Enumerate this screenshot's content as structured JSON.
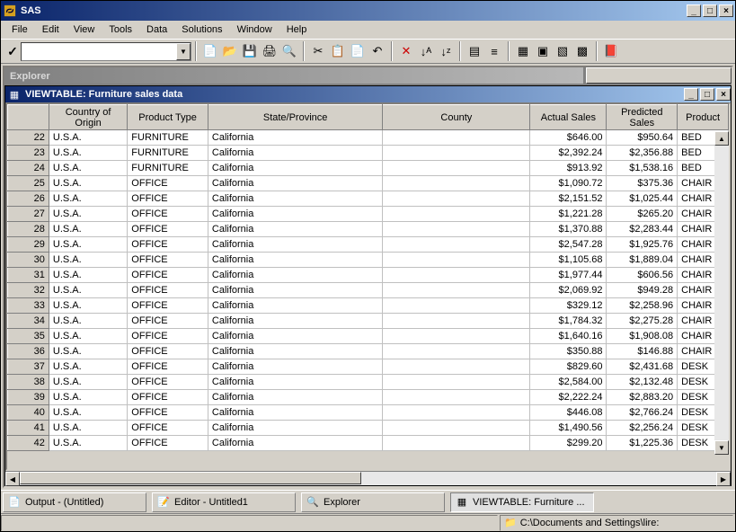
{
  "app": {
    "title": "SAS"
  },
  "menu": [
    "File",
    "Edit",
    "View",
    "Tools",
    "Data",
    "Solutions",
    "Window",
    "Help"
  ],
  "explorer_label": "Explorer",
  "viewtable": {
    "title": "VIEWTABLE: Furniture sales data"
  },
  "columns": [
    {
      "key": "country",
      "label": "Country of Origin",
      "w": 80,
      "align": "left"
    },
    {
      "key": "ptype",
      "label": "Product Type",
      "w": 82,
      "align": "left"
    },
    {
      "key": "state",
      "label": "State/Province",
      "w": 178,
      "align": "left"
    },
    {
      "key": "county",
      "label": "County",
      "w": 150,
      "align": "left"
    },
    {
      "key": "actual",
      "label": "Actual Sales",
      "w": 78,
      "align": "right"
    },
    {
      "key": "predicted",
      "label": "Predicted Sales",
      "w": 72,
      "align": "right"
    },
    {
      "key": "product",
      "label": "Product",
      "w": 52,
      "align": "left"
    }
  ],
  "rows": [
    {
      "n": 22,
      "country": "U.S.A.",
      "ptype": "FURNITURE",
      "state": "California",
      "county": "",
      "actual": "$646.00",
      "predicted": "$950.64",
      "product": "BED"
    },
    {
      "n": 23,
      "country": "U.S.A.",
      "ptype": "FURNITURE",
      "state": "California",
      "county": "",
      "actual": "$2,392.24",
      "predicted": "$2,356.88",
      "product": "BED"
    },
    {
      "n": 24,
      "country": "U.S.A.",
      "ptype": "FURNITURE",
      "state": "California",
      "county": "",
      "actual": "$913.92",
      "predicted": "$1,538.16",
      "product": "BED"
    },
    {
      "n": 25,
      "country": "U.S.A.",
      "ptype": "OFFICE",
      "state": "California",
      "county": "",
      "actual": "$1,090.72",
      "predicted": "$375.36",
      "product": "CHAIR"
    },
    {
      "n": 26,
      "country": "U.S.A.",
      "ptype": "OFFICE",
      "state": "California",
      "county": "",
      "actual": "$2,151.52",
      "predicted": "$1,025.44",
      "product": "CHAIR"
    },
    {
      "n": 27,
      "country": "U.S.A.",
      "ptype": "OFFICE",
      "state": "California",
      "county": "",
      "actual": "$1,221.28",
      "predicted": "$265.20",
      "product": "CHAIR"
    },
    {
      "n": 28,
      "country": "U.S.A.",
      "ptype": "OFFICE",
      "state": "California",
      "county": "",
      "actual": "$1,370.88",
      "predicted": "$2,283.44",
      "product": "CHAIR"
    },
    {
      "n": 29,
      "country": "U.S.A.",
      "ptype": "OFFICE",
      "state": "California",
      "county": "",
      "actual": "$2,547.28",
      "predicted": "$1,925.76",
      "product": "CHAIR"
    },
    {
      "n": 30,
      "country": "U.S.A.",
      "ptype": "OFFICE",
      "state": "California",
      "county": "",
      "actual": "$1,105.68",
      "predicted": "$1,889.04",
      "product": "CHAIR"
    },
    {
      "n": 31,
      "country": "U.S.A.",
      "ptype": "OFFICE",
      "state": "California",
      "county": "",
      "actual": "$1,977.44",
      "predicted": "$606.56",
      "product": "CHAIR"
    },
    {
      "n": 32,
      "country": "U.S.A.",
      "ptype": "OFFICE",
      "state": "California",
      "county": "",
      "actual": "$2,069.92",
      "predicted": "$949.28",
      "product": "CHAIR"
    },
    {
      "n": 33,
      "country": "U.S.A.",
      "ptype": "OFFICE",
      "state": "California",
      "county": "",
      "actual": "$329.12",
      "predicted": "$2,258.96",
      "product": "CHAIR"
    },
    {
      "n": 34,
      "country": "U.S.A.",
      "ptype": "OFFICE",
      "state": "California",
      "county": "",
      "actual": "$1,784.32",
      "predicted": "$2,275.28",
      "product": "CHAIR"
    },
    {
      "n": 35,
      "country": "U.S.A.",
      "ptype": "OFFICE",
      "state": "California",
      "county": "",
      "actual": "$1,640.16",
      "predicted": "$1,908.08",
      "product": "CHAIR"
    },
    {
      "n": 36,
      "country": "U.S.A.",
      "ptype": "OFFICE",
      "state": "California",
      "county": "",
      "actual": "$350.88",
      "predicted": "$146.88",
      "product": "CHAIR"
    },
    {
      "n": 37,
      "country": "U.S.A.",
      "ptype": "OFFICE",
      "state": "California",
      "county": "",
      "actual": "$829.60",
      "predicted": "$2,431.68",
      "product": "DESK"
    },
    {
      "n": 38,
      "country": "U.S.A.",
      "ptype": "OFFICE",
      "state": "California",
      "county": "",
      "actual": "$2,584.00",
      "predicted": "$2,132.48",
      "product": "DESK"
    },
    {
      "n": 39,
      "country": "U.S.A.",
      "ptype": "OFFICE",
      "state": "California",
      "county": "",
      "actual": "$2,222.24",
      "predicted": "$2,883.20",
      "product": "DESK"
    },
    {
      "n": 40,
      "country": "U.S.A.",
      "ptype": "OFFICE",
      "state": "California",
      "county": "",
      "actual": "$446.08",
      "predicted": "$2,766.24",
      "product": "DESK"
    },
    {
      "n": 41,
      "country": "U.S.A.",
      "ptype": "OFFICE",
      "state": "California",
      "county": "",
      "actual": "$1,490.56",
      "predicted": "$2,256.24",
      "product": "DESK"
    },
    {
      "n": 42,
      "country": "U.S.A.",
      "ptype": "OFFICE",
      "state": "California",
      "county": "",
      "actual": "$299.20",
      "predicted": "$1,225.36",
      "product": "DESK"
    }
  ],
  "tasks": [
    {
      "icon": "📄",
      "label": "Output - (Untitled)",
      "active": false
    },
    {
      "icon": "📝",
      "label": "Editor - Untitled1",
      "active": false
    },
    {
      "icon": "🔍",
      "label": "Explorer",
      "active": false
    },
    {
      "icon": "▦",
      "label": "VIEWTABLE: Furniture ...",
      "active": true
    }
  ],
  "status": {
    "path": "C:\\Documents and Settings\\lire:"
  }
}
